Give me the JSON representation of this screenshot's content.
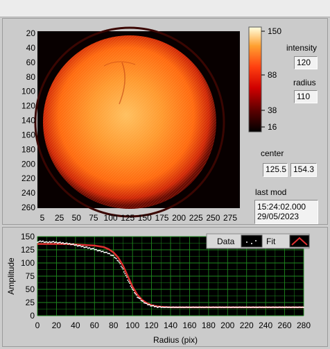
{
  "image_panel": {
    "x_ticks": [
      "5",
      "25",
      "50",
      "75",
      "100",
      "125",
      "150",
      "175",
      "200",
      "225",
      "250",
      "275"
    ],
    "y_ticks": [
      "20",
      "40",
      "60",
      "80",
      "100",
      "120",
      "140",
      "160",
      "180",
      "200",
      "220",
      "240",
      "260"
    ]
  },
  "colorbar": {
    "max_label": "150",
    "mid_label": "88",
    "low_label": "38",
    "min_label": "16"
  },
  "intensity": {
    "label": "intensity",
    "value": "120"
  },
  "radius": {
    "label": "radius",
    "value": "110"
  },
  "center": {
    "label": "center",
    "x": "125.5",
    "y": "154.3"
  },
  "last_mod": {
    "label": "last mod",
    "value": "15:24:02.000\n29/05/2023"
  },
  "legend": {
    "data_label": "Data",
    "fit_label": "Fit"
  },
  "chart_data": {
    "type": "scatter",
    "xlabel": "Radius (pix)",
    "ylabel": "Amplitude",
    "xlim": [
      0,
      280
    ],
    "ylim": [
      0,
      150
    ],
    "x_ticks": [
      0,
      20,
      40,
      60,
      80,
      100,
      120,
      140,
      160,
      180,
      200,
      220,
      240,
      260,
      280
    ],
    "y_ticks": [
      0,
      25,
      50,
      75,
      100,
      125,
      150
    ],
    "grid": true,
    "legend_position": "top-right",
    "colors": {
      "data": "#ffffff",
      "fit": "#e03030",
      "plot_bg": "#000000",
      "grid": "#1f8a1f"
    },
    "series": [
      {
        "name": "Data",
        "x": [
          0,
          5,
          10,
          15,
          20,
          25,
          30,
          35,
          40,
          45,
          50,
          55,
          60,
          65,
          70,
          75,
          80,
          85,
          90,
          95,
          100,
          105,
          110,
          115,
          120,
          125,
          130,
          140,
          160,
          180,
          200,
          220,
          240,
          260,
          280
        ],
        "values": [
          140,
          141,
          139,
          140,
          139,
          138,
          137,
          136,
          134,
          132,
          130,
          128,
          126,
          123,
          121,
          118,
          113,
          104,
          88,
          68,
          50,
          36,
          28,
          22,
          19,
          17,
          16,
          16,
          16,
          16,
          16,
          16,
          16,
          16,
          16
        ]
      },
      {
        "name": "Fit",
        "x": [
          0,
          10,
          20,
          30,
          40,
          50,
          60,
          70,
          75,
          80,
          85,
          90,
          95,
          100,
          105,
          110,
          115,
          120,
          125,
          130,
          140,
          160,
          200,
          240,
          280
        ],
        "values": [
          136,
          136,
          136,
          136,
          135,
          134,
          133,
          130,
          126,
          120,
          110,
          95,
          75,
          55,
          40,
          30,
          24,
          20,
          18,
          17,
          16,
          16,
          16,
          16,
          16
        ]
      }
    ]
  }
}
